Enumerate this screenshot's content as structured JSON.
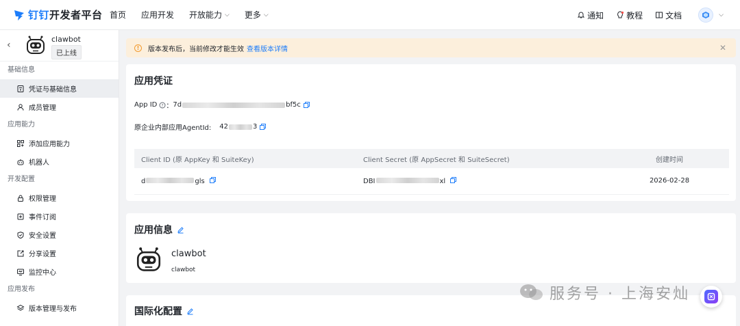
{
  "brand": {
    "name_part1": "钉钉",
    "name_part2": "开发者平台"
  },
  "nav": {
    "items": [
      {
        "label": "首页"
      },
      {
        "label": "应用开发"
      },
      {
        "label": "开放能力",
        "has_dropdown": true
      },
      {
        "label": "更多",
        "has_dropdown": true
      }
    ]
  },
  "top_right": {
    "notify": "通知",
    "tutorial": "教程",
    "docs": "文档"
  },
  "sidebar": {
    "app_name": "clawbot",
    "app_status": "已上线",
    "groups": [
      {
        "title": "基础信息",
        "items": [
          {
            "label": "凭证与基础信息",
            "icon": "credential-icon",
            "active": true
          },
          {
            "label": "成员管理",
            "icon": "user-icon"
          }
        ]
      },
      {
        "title": "应用能力",
        "items": [
          {
            "label": "添加应用能力",
            "icon": "apps-add-icon"
          },
          {
            "label": "机器人",
            "icon": "robot-icon"
          }
        ]
      },
      {
        "title": "开发配置",
        "items": [
          {
            "label": "权限管理",
            "icon": "lock-icon"
          },
          {
            "label": "事件订阅",
            "icon": "event-icon"
          },
          {
            "label": "安全设置",
            "icon": "shield-icon"
          },
          {
            "label": "分享设置",
            "icon": "share-icon"
          },
          {
            "label": "监控中心",
            "icon": "monitor-icon"
          }
        ]
      },
      {
        "title": "应用发布",
        "items": [
          {
            "label": "版本管理与发布",
            "icon": "layers-icon"
          }
        ]
      }
    ]
  },
  "notice": {
    "text": "版本发布后，当前修改才能生效",
    "link": "查看版本详情"
  },
  "credentials": {
    "title": "应用凭证",
    "app_id_label": "App ID",
    "app_id_sep": "：",
    "app_id_prefix": "7d",
    "app_id_suffix": "bf5c",
    "agent_label": "原企业内部应用AgentId:",
    "agent_prefix": "42",
    "agent_suffix": "3",
    "table": {
      "headers": [
        "Client ID (原 AppKey 和 SuiteKey)",
        "Client Secret (原 AppSecret 和 SuiteSecret)",
        "创建时间"
      ],
      "row": {
        "client_id_prefix": "d",
        "client_id_suffix": "gls",
        "secret_prefix": "DBI",
        "secret_suffix": "xl",
        "created": "2026-02-28"
      }
    }
  },
  "app_info": {
    "title": "应用信息",
    "name": "clawbot",
    "sub": "clawbot"
  },
  "i18n": {
    "title": "国际化配置"
  },
  "watermark": {
    "text": "服务号 · 上海安灿"
  },
  "colors": {
    "accent": "#1d7dfa",
    "notice_bg": "#fcefdc",
    "warning": "#f29b2f"
  }
}
